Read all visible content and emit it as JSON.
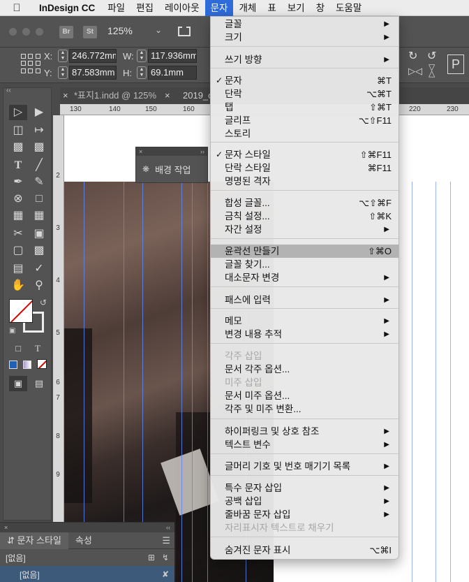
{
  "menubar": {
    "apple": "",
    "app_name": "InDesign CC",
    "items": [
      "파일",
      "편집",
      "레이아웃",
      "문자",
      "개체",
      "표",
      "보기",
      "창",
      "도움말"
    ],
    "active_index": 3
  },
  "appbar": {
    "bridge_label": "Br",
    "stock_label": "St",
    "zoom": "125%"
  },
  "control": {
    "x_label": "X:",
    "x_value": "246.772mm",
    "y_label": "Y:",
    "y_value": "87.583mm",
    "w_label": "W:",
    "w_value": "117.936mm",
    "h_label": "H:",
    "h_value": "69.1mm"
  },
  "tabs": [
    {
      "title": "*표지1.indd @ 125%"
    },
    {
      "title": "2019_c"
    }
  ],
  "ruler": {
    "h_ticks": [
      "130",
      "140",
      "150",
      "160",
      "220",
      "230"
    ],
    "v_ticks": [
      "2",
      "3",
      "4",
      "5",
      "6",
      "7",
      "8",
      "9",
      "1"
    ]
  },
  "bg_panel": {
    "label": "배경 작업"
  },
  "style_panel": {
    "tab_active": "문자 스타일",
    "tab_other": "속성",
    "row1": "[없음]",
    "row2": "[없음]"
  },
  "menu": {
    "items": [
      {
        "label": "글꼴",
        "submenu": true
      },
      {
        "label": "크기",
        "submenu": true
      },
      {
        "label": "쓰기 방향",
        "submenu": true
      },
      {
        "label": "문자",
        "checked": true,
        "shortcut": "⌘T"
      },
      {
        "label": "단락",
        "shortcut": "⌥⌘T"
      },
      {
        "label": "탭",
        "shortcut": "⇧⌘T"
      },
      {
        "label": "글리프",
        "shortcut": "⌥⇧F11"
      },
      {
        "label": "스토리"
      },
      {
        "label": "문자 스타일",
        "checked": true,
        "shortcut": "⇧⌘F11"
      },
      {
        "label": "단락 스타일",
        "shortcut": "⌘F11"
      },
      {
        "label": "명명된 격자"
      },
      {
        "label": "합성 글꼴...",
        "shortcut": "⌥⇧⌘F"
      },
      {
        "label": "금칙 설정...",
        "shortcut": "⇧⌘K"
      },
      {
        "label": "자간 설정",
        "submenu": true
      },
      {
        "label": "윤곽선 만들기",
        "shortcut": "⇧⌘O",
        "highlighted": true
      },
      {
        "label": "글꼴 찾기..."
      },
      {
        "label": "대소문자 변경",
        "submenu": true
      },
      {
        "label": "패스에 입력",
        "submenu": true
      },
      {
        "label": "메모",
        "submenu": true
      },
      {
        "label": "변경 내용 추적",
        "submenu": true
      },
      {
        "label": "각주 삽입",
        "disabled": true
      },
      {
        "label": "문서 각주 옵션..."
      },
      {
        "label": "미주 삽입",
        "disabled": true
      },
      {
        "label": "문서 미주 옵션..."
      },
      {
        "label": "각주 및 미주 변환..."
      },
      {
        "label": "하이퍼링크 및 상호 참조",
        "submenu": true
      },
      {
        "label": "텍스트 변수",
        "submenu": true
      },
      {
        "label": "글머리 기호 및 번호 매기기 목록",
        "submenu": true
      },
      {
        "label": "특수 문자 삽입",
        "submenu": true
      },
      {
        "label": "공백 삽입",
        "submenu": true
      },
      {
        "label": "줄바꿈 문자 삽입",
        "submenu": true
      },
      {
        "label": "자리표시자 텍스트로 채우기",
        "disabled": true
      },
      {
        "label": "숨겨진 문자 표시",
        "shortcut": "⌥⌘I"
      }
    ]
  }
}
